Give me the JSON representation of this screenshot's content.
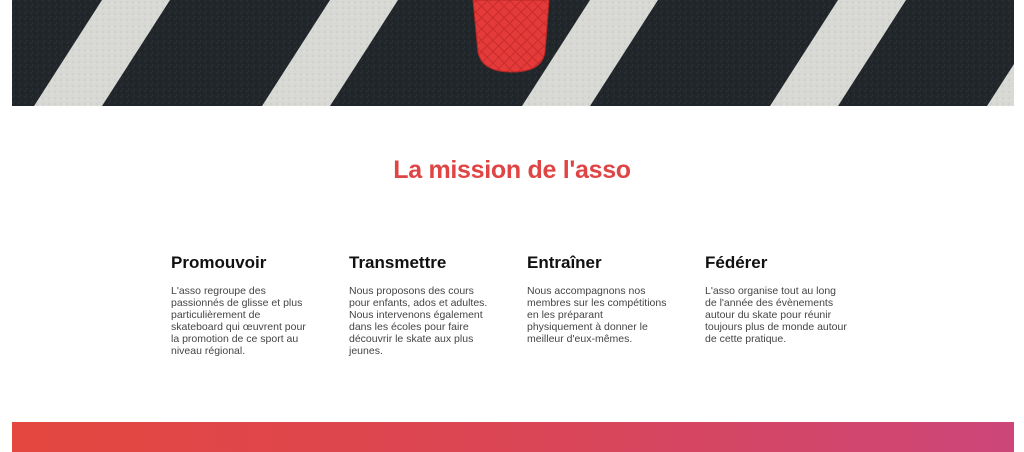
{
  "hero": {
    "image": "asphalt-crosswalk-red-skateboard",
    "colors": {
      "asphalt": "#20262a",
      "stripe": "#d6d6d3",
      "skateboard": "#e23b3b"
    }
  },
  "mission": {
    "title": "La mission de l'asso",
    "title_color": "#e04545"
  },
  "features": [
    {
      "title": "Promouvoir",
      "text_lines": [
        "L'asso regroupe des",
        "passionnés de glisse et plus",
        "particulièrement de",
        "skateboard qui œuvrent pour",
        "la promotion de ce sport au",
        "niveau régional."
      ]
    },
    {
      "title": "Transmettre",
      "text_lines": [
        "Nous proposons des cours",
        "pour enfants, ados et adultes.",
        "Nous intervenons également",
        "dans les écoles pour faire",
        "découvrir le skate aux plus",
        "jeunes."
      ]
    },
    {
      "title": "Entraîner",
      "text_lines": [
        "Nous accompagnons nos",
        "membres sur les compétitions",
        "en les préparant",
        "physiquement à donner le",
        "meilleur d'eux-mêmes."
      ]
    },
    {
      "title": "Fédérer",
      "text_lines": [
        "L'asso organise tout au long",
        "de l'année des évènements",
        "autour du skate pour réunir",
        "toujours plus de monde autour",
        "de cette pratique."
      ]
    }
  ],
  "footer_band": {
    "gradient_from": "#e4473f",
    "gradient_to": "#cc4679"
  }
}
